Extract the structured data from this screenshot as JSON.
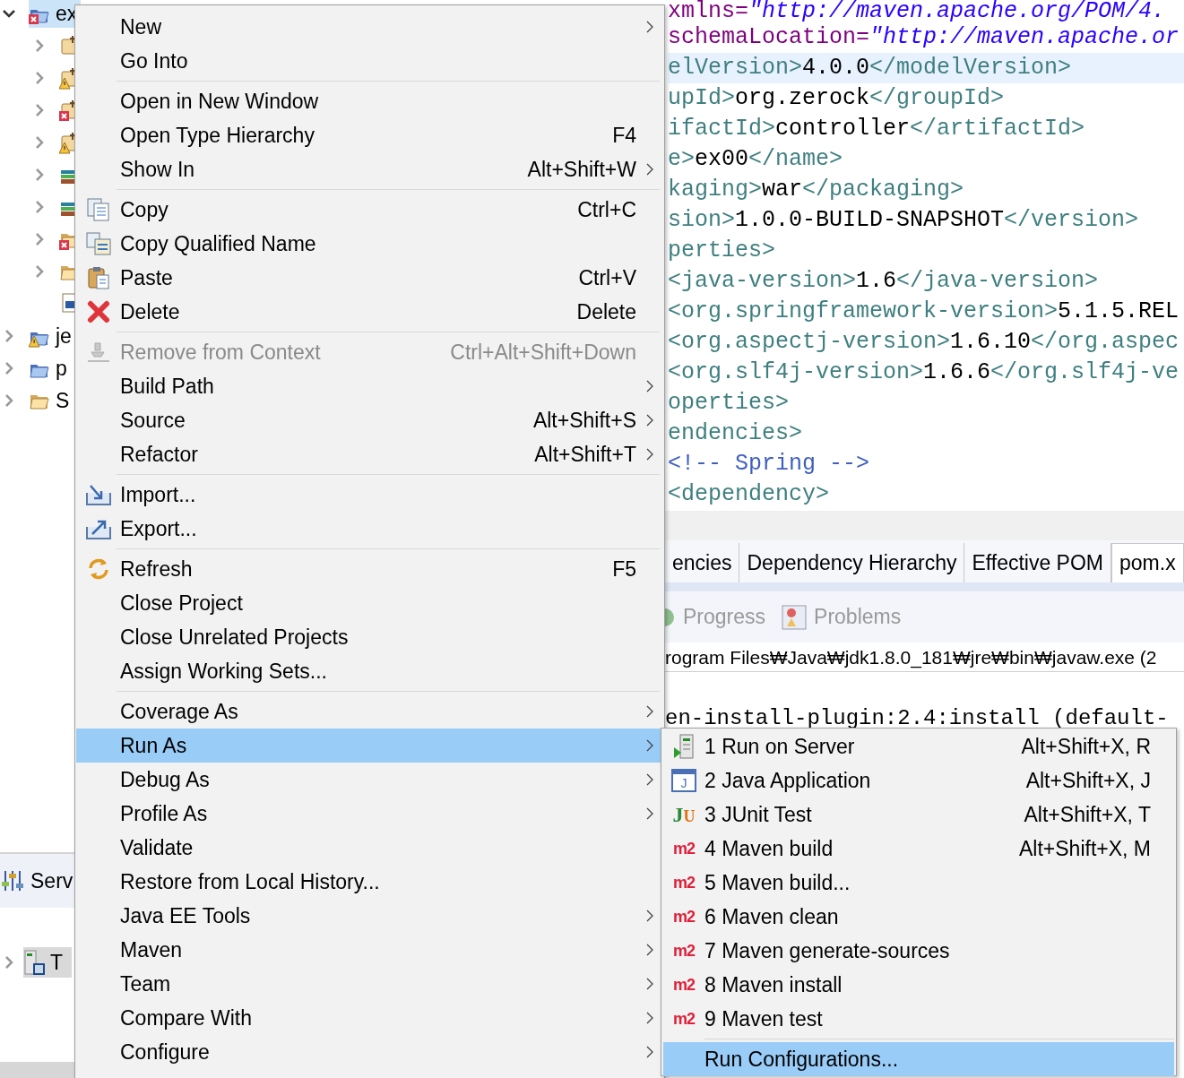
{
  "project_explorer": {
    "tree": [
      {
        "label": "ex",
        "kind": "project-error",
        "expanded": true,
        "selected": true,
        "children": [
          {
            "kind": "package",
            "expanded": false,
            "selected": false
          },
          {
            "kind": "package-warning",
            "expanded": false,
            "selected": false
          },
          {
            "kind": "package-error",
            "expanded": false,
            "selected": false
          },
          {
            "kind": "package-warning",
            "expanded": false,
            "selected": false
          },
          {
            "kind": "library",
            "expanded": false,
            "selected": false
          },
          {
            "kind": "library",
            "expanded": false,
            "selected": false
          },
          {
            "kind": "folder-error",
            "expanded": false,
            "selected": false
          },
          {
            "kind": "folder",
            "expanded": false,
            "selected": false
          },
          {
            "kind": "file",
            "selected": false
          }
        ]
      },
      {
        "label": "je",
        "kind": "project-warning",
        "expanded": false,
        "selected": false
      },
      {
        "label": "p",
        "kind": "project",
        "expanded": false,
        "selected": false
      },
      {
        "label": "S",
        "kind": "folder",
        "expanded": false,
        "selected": false
      }
    ]
  },
  "servers_view": {
    "title": "Serv",
    "rows": [
      {
        "label": "T",
        "expanded": false,
        "selected": true
      }
    ]
  },
  "editor": {
    "lines": [
      {
        "current": false,
        "segments": [
          {
            "kind": "attr",
            "text": "xmlns="
          },
          {
            "kind": "value",
            "text": "\"http://maven.apache.org/POM/4."
          }
        ]
      },
      {
        "current": false,
        "segments": [
          {
            "kind": "attr",
            "text": "schemaLocation="
          },
          {
            "kind": "value",
            "text": "\"http://maven.apache.or"
          }
        ]
      },
      {
        "current": true,
        "segments": [
          {
            "kind": "tag",
            "text": "elVersion>"
          },
          {
            "kind": "text",
            "text": "4.0.0"
          },
          {
            "kind": "tag",
            "text": "</modelVersion>"
          }
        ]
      },
      {
        "current": false,
        "segments": [
          {
            "kind": "tag",
            "text": "upId>"
          },
          {
            "kind": "text",
            "text": "org.zerock"
          },
          {
            "kind": "tag",
            "text": "</groupId>"
          }
        ]
      },
      {
        "current": false,
        "segments": [
          {
            "kind": "tag",
            "text": "ifactId>"
          },
          {
            "kind": "text",
            "text": "controller"
          },
          {
            "kind": "tag",
            "text": "</artifactId>"
          }
        ]
      },
      {
        "current": false,
        "segments": [
          {
            "kind": "tag",
            "text": "e>"
          },
          {
            "kind": "text",
            "text": "ex00"
          },
          {
            "kind": "tag",
            "text": "</name>"
          }
        ]
      },
      {
        "current": false,
        "segments": [
          {
            "kind": "tag",
            "text": "kaging>"
          },
          {
            "kind": "text",
            "text": "war"
          },
          {
            "kind": "tag",
            "text": "</packaging>"
          }
        ]
      },
      {
        "current": false,
        "segments": [
          {
            "kind": "tag",
            "text": "sion>"
          },
          {
            "kind": "text",
            "text": "1.0.0-BUILD-SNAPSHOT"
          },
          {
            "kind": "tag",
            "text": "</version>"
          }
        ]
      },
      {
        "current": false,
        "segments": [
          {
            "kind": "tag",
            "text": "perties>"
          }
        ]
      },
      {
        "current": false,
        "segments": [
          {
            "kind": "tag",
            "text": "<java-version>"
          },
          {
            "kind": "text",
            "text": "1.6"
          },
          {
            "kind": "tag",
            "text": "</java-version>"
          }
        ]
      },
      {
        "current": false,
        "segments": [
          {
            "kind": "tag",
            "text": "<org.springframework-version>"
          },
          {
            "kind": "text",
            "text": "5.1.5.REL"
          }
        ]
      },
      {
        "current": false,
        "segments": [
          {
            "kind": "tag",
            "text": "<org.aspectj-version>"
          },
          {
            "kind": "text",
            "text": "1.6.10"
          },
          {
            "kind": "tag",
            "text": "</org.aspec"
          }
        ]
      },
      {
        "current": false,
        "segments": [
          {
            "kind": "tag",
            "text": "<org.slf4j-version>"
          },
          {
            "kind": "text",
            "text": "1.6.6"
          },
          {
            "kind": "tag",
            "text": "</org.slf4j-ve"
          }
        ]
      },
      {
        "current": false,
        "segments": [
          {
            "kind": "tag",
            "text": "operties>"
          }
        ]
      },
      {
        "current": false,
        "segments": [
          {
            "kind": "tag",
            "text": "endencies>"
          }
        ]
      },
      {
        "current": false,
        "segments": [
          {
            "kind": "comment",
            "text": "<!-- Spring -->"
          }
        ]
      },
      {
        "current": false,
        "segments": [
          {
            "kind": "tag",
            "text": "<dependency>"
          }
        ]
      }
    ]
  },
  "editor_tabs": [
    {
      "label": "encies",
      "selected": false
    },
    {
      "label": "Dependency Hierarchy",
      "selected": false
    },
    {
      "label": "Effective POM",
      "selected": false
    },
    {
      "label": "pom.x",
      "selected": true
    }
  ],
  "views": [
    {
      "label": "Progress",
      "kind": "progress"
    },
    {
      "label": "Problems",
      "kind": "problems"
    }
  ],
  "console": {
    "header": "rogram Files₩Java₩jdk1.8.0_181₩jre₩bin₩javaw.exe (2",
    "lines": [
      "en-install-plugin:2.4:install (default-"
    ]
  },
  "context_menu": {
    "groups": [
      [
        {
          "label": "New",
          "has_submenu": true,
          "selected": false,
          "disabled": false
        },
        {
          "label": "Go Into",
          "has_submenu": false,
          "selected": false,
          "disabled": false
        }
      ],
      [
        {
          "label": "Open in New Window",
          "has_submenu": false,
          "selected": false,
          "disabled": false
        },
        {
          "label": "Open Type Hierarchy",
          "shortcut": "F4",
          "has_submenu": false,
          "selected": false,
          "disabled": false
        },
        {
          "label": "Show In",
          "shortcut": "Alt+Shift+W",
          "has_submenu": true,
          "selected": false,
          "disabled": false
        }
      ],
      [
        {
          "label": "Copy",
          "shortcut": "Ctrl+C",
          "kind": "copy",
          "has_submenu": false,
          "selected": false,
          "disabled": false
        },
        {
          "label": "Copy Qualified Name",
          "kind": "copy-qualified",
          "has_submenu": false,
          "selected": false,
          "disabled": false
        },
        {
          "label": "Paste",
          "shortcut": "Ctrl+V",
          "kind": "paste",
          "has_submenu": false,
          "selected": false,
          "disabled": false
        },
        {
          "label": "Delete",
          "shortcut": "Delete",
          "kind": "delete",
          "has_submenu": false,
          "selected": false,
          "disabled": false
        }
      ],
      [
        {
          "label": "Remove from Context",
          "shortcut": "Ctrl+Alt+Shift+Down",
          "kind": "remove",
          "has_submenu": false,
          "selected": false,
          "disabled": true
        },
        {
          "label": "Build Path",
          "has_submenu": true,
          "selected": false,
          "disabled": false
        },
        {
          "label": "Source",
          "shortcut": "Alt+Shift+S",
          "has_submenu": true,
          "selected": false,
          "disabled": false
        },
        {
          "label": "Refactor",
          "shortcut": "Alt+Shift+T",
          "has_submenu": true,
          "selected": false,
          "disabled": false
        }
      ],
      [
        {
          "label": "Import...",
          "kind": "import",
          "has_submenu": false,
          "selected": false,
          "disabled": false
        },
        {
          "label": "Export...",
          "kind": "export",
          "has_submenu": false,
          "selected": false,
          "disabled": false
        }
      ],
      [
        {
          "label": "Refresh",
          "shortcut": "F5",
          "kind": "refresh",
          "has_submenu": false,
          "selected": false,
          "disabled": false
        },
        {
          "label": "Close Project",
          "has_submenu": false,
          "selected": false,
          "disabled": false
        },
        {
          "label": "Close Unrelated Projects",
          "has_submenu": false,
          "selected": false,
          "disabled": false
        },
        {
          "label": "Assign Working Sets...",
          "has_submenu": false,
          "selected": false,
          "disabled": false
        }
      ],
      [
        {
          "label": "Coverage As",
          "has_submenu": true,
          "selected": false,
          "disabled": false
        },
        {
          "label": "Run As",
          "has_submenu": true,
          "selected": true,
          "disabled": false
        },
        {
          "label": "Debug As",
          "has_submenu": true,
          "selected": false,
          "disabled": false
        },
        {
          "label": "Profile As",
          "has_submenu": true,
          "selected": false,
          "disabled": false
        },
        {
          "label": "Validate",
          "has_submenu": false,
          "selected": false,
          "disabled": false
        },
        {
          "label": "Restore from Local History...",
          "has_submenu": false,
          "selected": false,
          "disabled": false
        },
        {
          "label": "Java EE Tools",
          "has_submenu": true,
          "selected": false,
          "disabled": false
        },
        {
          "label": "Maven",
          "has_submenu": true,
          "selected": false,
          "disabled": false
        },
        {
          "label": "Team",
          "has_submenu": true,
          "selected": false,
          "disabled": false
        },
        {
          "label": "Compare With",
          "has_submenu": true,
          "selected": false,
          "disabled": false
        },
        {
          "label": "Configure",
          "has_submenu": true,
          "selected": false,
          "disabled": false
        }
      ]
    ]
  },
  "run_as_submenu": {
    "groups": [
      [
        {
          "label": "1 Run on Server",
          "shortcut": "Alt+Shift+X, R",
          "icon": {
            "kind": "server"
          },
          "selected": false
        },
        {
          "label": "2 Java Application",
          "shortcut": "Alt+Shift+X, J",
          "icon": {
            "kind": "java-app",
            "letters": [
              "J"
            ]
          },
          "selected": false
        },
        {
          "label": "3 JUnit Test",
          "shortcut": "Alt+Shift+X, T",
          "icon": {
            "kind": "junit",
            "letters": [
              "J",
              "U"
            ]
          },
          "selected": false
        },
        {
          "label": "4 Maven build",
          "shortcut": "Alt+Shift+X, M",
          "icon": {
            "kind": "maven",
            "letters": [
              "m2"
            ]
          },
          "selected": false
        },
        {
          "label": "5 Maven build...",
          "icon": {
            "kind": "maven",
            "letters": [
              "m2"
            ]
          },
          "selected": false
        },
        {
          "label": "6 Maven clean",
          "icon": {
            "kind": "maven",
            "letters": [
              "m2"
            ]
          },
          "selected": false
        },
        {
          "label": "7 Maven generate-sources",
          "icon": {
            "kind": "maven",
            "letters": [
              "m2"
            ]
          },
          "selected": false
        },
        {
          "label": "8 Maven install",
          "icon": {
            "kind": "maven",
            "letters": [
              "m2"
            ]
          },
          "selected": false
        },
        {
          "label": "9 Maven test",
          "icon": {
            "kind": "maven",
            "letters": [
              "m2"
            ]
          },
          "selected": false
        }
      ],
      [
        {
          "label": "Run Configurations...",
          "selected": true
        }
      ]
    ]
  }
}
